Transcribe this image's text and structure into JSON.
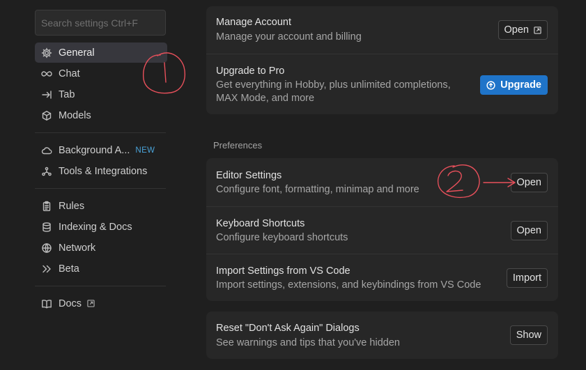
{
  "search": {
    "placeholder": "Search settings Ctrl+F"
  },
  "sidebar": {
    "group1": [
      {
        "label": "General",
        "icon": "gear-icon",
        "active": true
      },
      {
        "label": "Chat",
        "icon": "infinity-icon"
      },
      {
        "label": "Tab",
        "icon": "tab-arrow-icon"
      },
      {
        "label": "Models",
        "icon": "cube-icon"
      }
    ],
    "group2": [
      {
        "label": "Background A...",
        "icon": "cloud-icon",
        "badge": "NEW"
      },
      {
        "label": "Tools & Integrations",
        "icon": "integrations-icon"
      }
    ],
    "group3": [
      {
        "label": "Rules",
        "icon": "clipboard-icon"
      },
      {
        "label": "Indexing & Docs",
        "icon": "database-icon"
      },
      {
        "label": "Network",
        "icon": "globe-icon"
      },
      {
        "label": "Beta",
        "icon": "double-chevron-icon"
      }
    ],
    "group4": [
      {
        "label": "Docs",
        "icon": "book-icon"
      }
    ]
  },
  "account": {
    "manage": {
      "title": "Manage Account",
      "desc": "Manage your account and billing",
      "button": "Open"
    },
    "upgrade": {
      "title": "Upgrade to Pro",
      "desc": "Get everything in Hobby, plus unlimited completions, MAX Mode, and more",
      "button": "Upgrade"
    }
  },
  "preferences": {
    "label": "Preferences",
    "editor": {
      "title": "Editor Settings",
      "desc": "Configure font, formatting, minimap and more",
      "button": "Open"
    },
    "keyboard": {
      "title": "Keyboard Shortcuts",
      "desc": "Configure keyboard shortcuts",
      "button": "Open"
    },
    "import": {
      "title": "Import Settings from VS Code",
      "desc": "Import settings, extensions, and keybindings from VS Code",
      "button": "Import"
    }
  },
  "reset": {
    "title": "Reset \"Don't Ask Again\" Dialogs",
    "desc": "See warnings and tips that you've hidden",
    "button": "Show"
  },
  "colors": {
    "accent": "#1f74c9",
    "annotation": "#e8505b",
    "new_badge": "#4aa3d9"
  }
}
